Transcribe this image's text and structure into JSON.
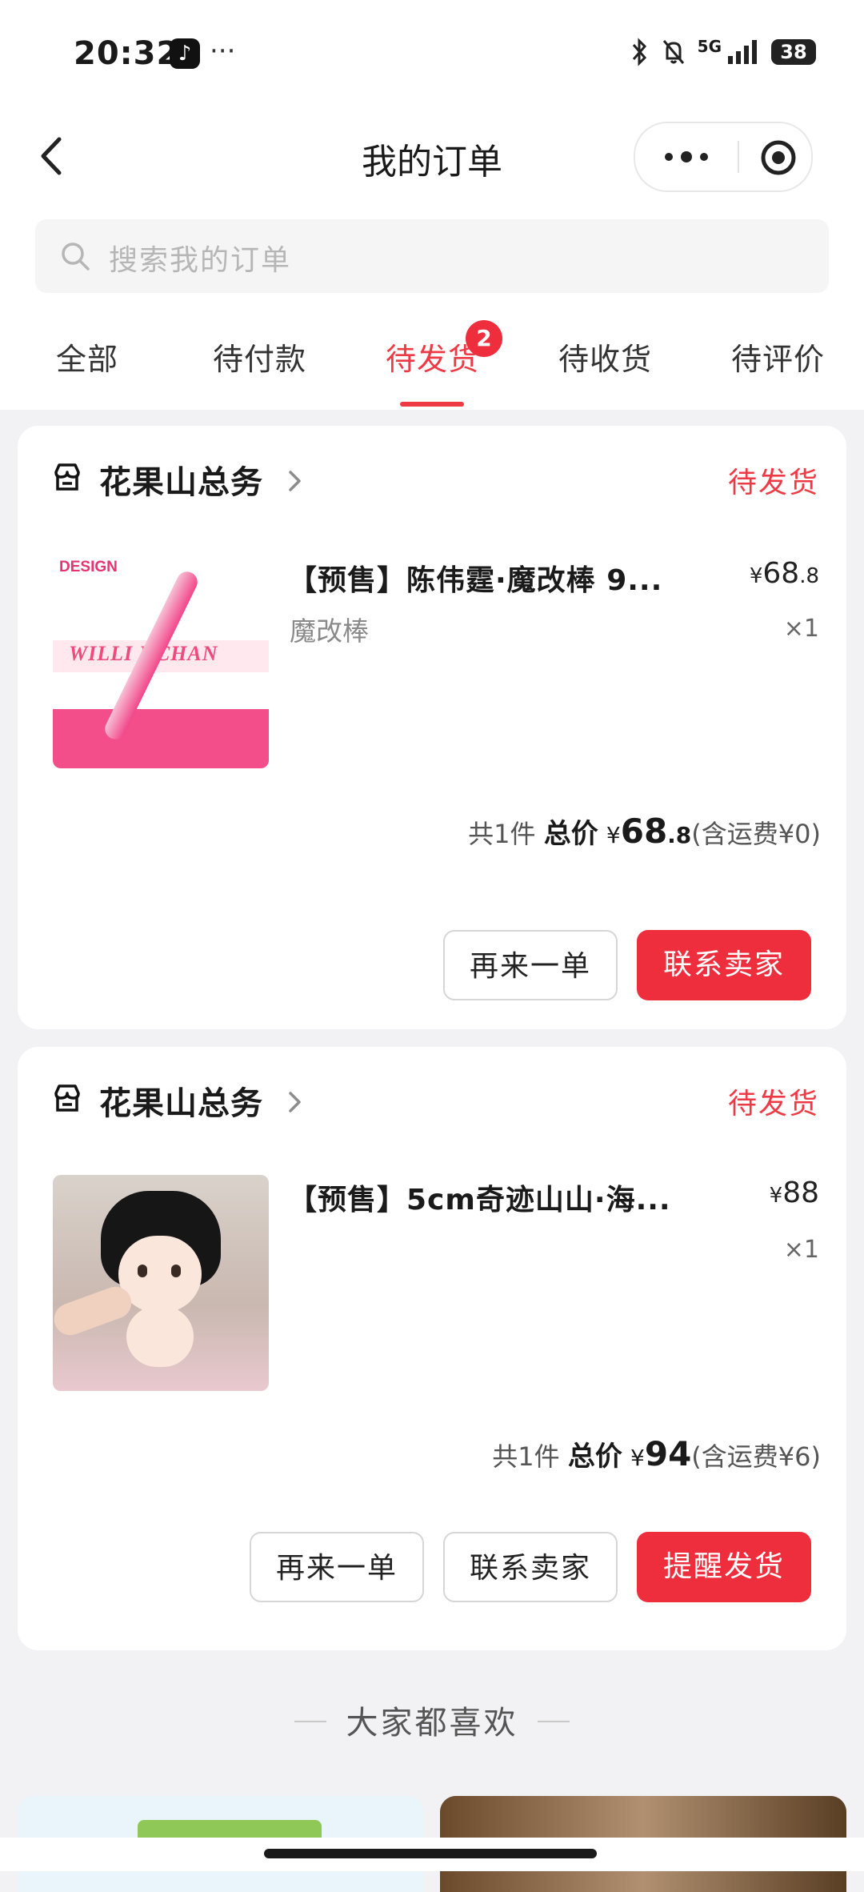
{
  "status_bar": {
    "time": "20:32",
    "tiktok_glyph": "♪",
    "more": "···",
    "network": "5G",
    "battery": "38"
  },
  "nav": {
    "title": "我的订单",
    "more_icon": "more-dots-icon",
    "target_icon": "target-icon"
  },
  "search": {
    "placeholder": "搜索我的订单"
  },
  "tabs": {
    "items": [
      {
        "label": "全部"
      },
      {
        "label": "待付款"
      },
      {
        "label": "待发货",
        "badge": "2"
      },
      {
        "label": "待收货"
      },
      {
        "label": "待评价"
      }
    ],
    "active_index": 2
  },
  "orders": [
    {
      "shop": "花果山总务",
      "status": "待发货",
      "product": {
        "title": "【预售】陈伟霆·魔改棒 9...",
        "spec": "魔改棒",
        "price_symbol": "¥",
        "price_int": "68",
        "price_dec": ".8",
        "qty": "×1",
        "thumb_text_top": "DESIGN",
        "thumb_text_mid": "WILLI HCHAN"
      },
      "summary": {
        "count": "共1件",
        "label": "总价",
        "symbol": "¥",
        "amount_int": "68",
        "amount_dec": ".8",
        "shipping": "(含运费¥0)"
      },
      "buttons": [
        "再来一单",
        "联系卖家"
      ]
    },
    {
      "shop": "花果山总务",
      "status": "待发货",
      "product": {
        "title": "【预售】5cm奇迹山山·海...",
        "spec": "",
        "price_symbol": "¥",
        "price_int": "88",
        "qty": "×1"
      },
      "summary": {
        "count": "共1件",
        "label": "总价",
        "symbol": "¥",
        "amount_int": "94",
        "shipping": "(含运费¥6)"
      },
      "buttons": [
        "再来一单",
        "联系卖家",
        "提醒发货"
      ]
    }
  ],
  "recommend": {
    "title": "大家都喜欢"
  },
  "colors": {
    "accent": "#ee3a45",
    "primary_button": "#ee2e3c",
    "background": "#f2f2f4"
  }
}
